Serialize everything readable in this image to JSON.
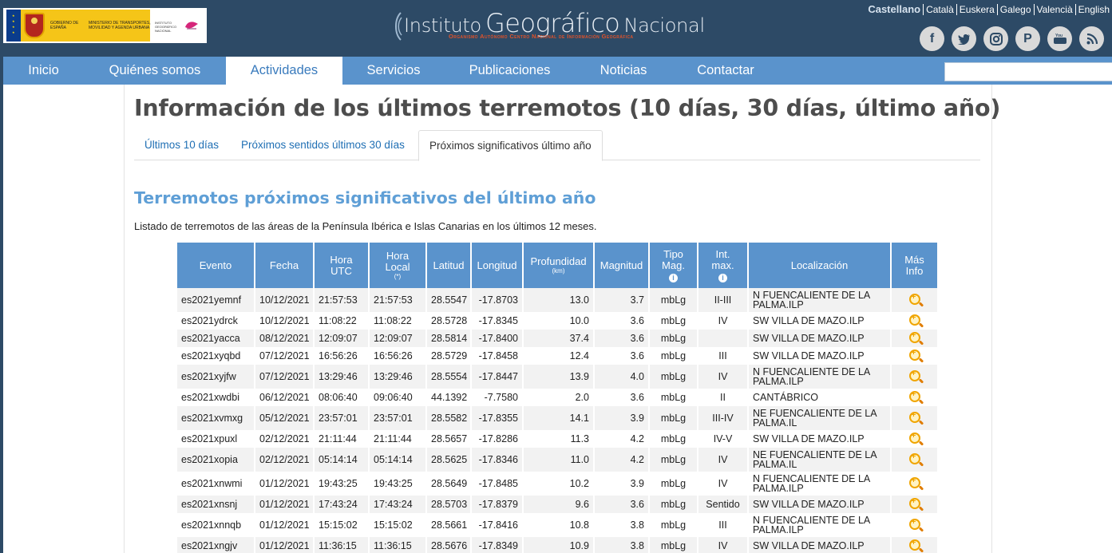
{
  "header": {
    "gov_text_1": "Gobierno de España",
    "gov_text_2": "Ministerio de Transportes, Movilidad y Agenda Urbana",
    "ign_text": "Instituto Geográfico Nacional",
    "site_title_instituto": "Instituto",
    "site_title_geografico": "Geográfico",
    "site_title_nacional": "Nacional",
    "site_subtitle": "Organismo Autónomo Centro Nacional de Información Geográfica",
    "languages": [
      "Castellano",
      "Català",
      "Euskera",
      "Galego",
      "Valencià",
      "English"
    ],
    "social": [
      "facebook-icon",
      "twitter-icon",
      "instagram-icon",
      "pinterest-icon",
      "youtube-icon",
      "rss-icon"
    ]
  },
  "nav": {
    "items": [
      "Inicio",
      "Quiénes somos",
      "Actividades",
      "Servicios",
      "Publicaciones",
      "Noticias",
      "Contactar"
    ],
    "active": "Actividades",
    "search_placeholder": ""
  },
  "page": {
    "title": "Información de los últimos terremotos (10 días, 30 días, último año)",
    "tabs": [
      "Últimos 10 días",
      "Próximos sentidos últimos 30 días",
      "Próximos significativos último año"
    ],
    "section_title": "Terremotos próximos significativos del último año",
    "intro": "Listado de terremotos de las áreas de la Península Ibérica e Islas Canarias en los últimos 12 meses."
  },
  "table": {
    "headers": {
      "evento": "Evento",
      "fecha": "Fecha",
      "hora_utc_1": "Hora",
      "hora_utc_2": "UTC",
      "hora_local_1": "Hora",
      "hora_local_2": "Local",
      "hora_local_sub": "(*)",
      "latitud": "Latitud",
      "longitud": "Longitud",
      "profundidad": "Profundidad",
      "profundidad_sub": "(km)",
      "magnitud": "Magnitud",
      "tipo_mag_1": "Tipo",
      "tipo_mag_2": "Mag.",
      "int_max_1": "Int.",
      "int_max_2": "max.",
      "localizacion": "Localización",
      "mas_info_1": "Más",
      "mas_info_2": "Info"
    },
    "rows": [
      {
        "evento": "es2021yemnf",
        "fecha": "10/12/2021",
        "utc": "21:57:53",
        "local": "21:57:53",
        "lat": "28.5547",
        "lon": "-17.8703",
        "prof": "13.0",
        "mag": "3.7",
        "tipo": "mbLg",
        "int": "II-III",
        "loc": "N FUENCALIENTE DE LA PALMA.ILP"
      },
      {
        "evento": "es2021ydrck",
        "fecha": "10/12/2021",
        "utc": "11:08:22",
        "local": "11:08:22",
        "lat": "28.5728",
        "lon": "-17.8345",
        "prof": "10.0",
        "mag": "3.6",
        "tipo": "mbLg",
        "int": "IV",
        "loc": "SW VILLA DE MAZO.ILP"
      },
      {
        "evento": "es2021yacca",
        "fecha": "08/12/2021",
        "utc": "12:09:07",
        "local": "12:09:07",
        "lat": "28.5814",
        "lon": "-17.8400",
        "prof": "37.4",
        "mag": "3.6",
        "tipo": "mbLg",
        "int": "",
        "loc": "SW VILLA DE MAZO.ILP"
      },
      {
        "evento": "es2021xyqbd",
        "fecha": "07/12/2021",
        "utc": "16:56:26",
        "local": "16:56:26",
        "lat": "28.5729",
        "lon": "-17.8458",
        "prof": "12.4",
        "mag": "3.6",
        "tipo": "mbLg",
        "int": "III",
        "loc": "SW VILLA DE MAZO.ILP"
      },
      {
        "evento": "es2021xyjfw",
        "fecha": "07/12/2021",
        "utc": "13:29:46",
        "local": "13:29:46",
        "lat": "28.5554",
        "lon": "-17.8447",
        "prof": "13.9",
        "mag": "4.0",
        "tipo": "mbLg",
        "int": "IV",
        "loc": "N FUENCALIENTE DE LA PALMA.ILP"
      },
      {
        "evento": "es2021xwdbi",
        "fecha": "06/12/2021",
        "utc": "08:06:40",
        "local": "09:06:40",
        "lat": "44.1392",
        "lon": "-7.7580",
        "prof": "2.0",
        "mag": "3.6",
        "tipo": "mbLg",
        "int": "II",
        "loc": "CANTÁBRICO"
      },
      {
        "evento": "es2021xvmxg",
        "fecha": "05/12/2021",
        "utc": "23:57:01",
        "local": "23:57:01",
        "lat": "28.5582",
        "lon": "-17.8355",
        "prof": "14.1",
        "mag": "3.9",
        "tipo": "mbLg",
        "int": "III-IV",
        "loc": "NE FUENCALIENTE DE LA PALMA.IL"
      },
      {
        "evento": "es2021xpuxl",
        "fecha": "02/12/2021",
        "utc": "21:11:44",
        "local": "21:11:44",
        "lat": "28.5657",
        "lon": "-17.8286",
        "prof": "11.3",
        "mag": "4.2",
        "tipo": "mbLg",
        "int": "IV-V",
        "loc": "SW VILLA DE MAZO.ILP"
      },
      {
        "evento": "es2021xopia",
        "fecha": "02/12/2021",
        "utc": "05:14:14",
        "local": "05:14:14",
        "lat": "28.5625",
        "lon": "-17.8346",
        "prof": "11.0",
        "mag": "4.2",
        "tipo": "mbLg",
        "int": "IV",
        "loc": "NE FUENCALIENTE DE LA PALMA.IL"
      },
      {
        "evento": "es2021xnwmi",
        "fecha": "01/12/2021",
        "utc": "19:43:25",
        "local": "19:43:25",
        "lat": "28.5649",
        "lon": "-17.8485",
        "prof": "10.2",
        "mag": "3.9",
        "tipo": "mbLg",
        "int": "IV",
        "loc": "N FUENCALIENTE DE LA PALMA.ILP"
      },
      {
        "evento": "es2021xnsnj",
        "fecha": "01/12/2021",
        "utc": "17:43:24",
        "local": "17:43:24",
        "lat": "28.5703",
        "lon": "-17.8379",
        "prof": "9.6",
        "mag": "3.6",
        "tipo": "mbLg",
        "int": "Sentido",
        "loc": "SW VILLA DE MAZO.ILP"
      },
      {
        "evento": "es2021xnnqb",
        "fecha": "01/12/2021",
        "utc": "15:15:02",
        "local": "15:15:02",
        "lat": "28.5661",
        "lon": "-17.8416",
        "prof": "10.8",
        "mag": "3.8",
        "tipo": "mbLg",
        "int": "III",
        "loc": "N FUENCALIENTE DE LA PALMA.ILP"
      },
      {
        "evento": "es2021xngjv",
        "fecha": "01/12/2021",
        "utc": "11:36:15",
        "local": "11:36:15",
        "lat": "28.5676",
        "lon": "-17.8349",
        "prof": "10.9",
        "mag": "3.8",
        "tipo": "mbLg",
        "int": "IV",
        "loc": "SW VILLA DE MAZO.ILP"
      }
    ]
  }
}
